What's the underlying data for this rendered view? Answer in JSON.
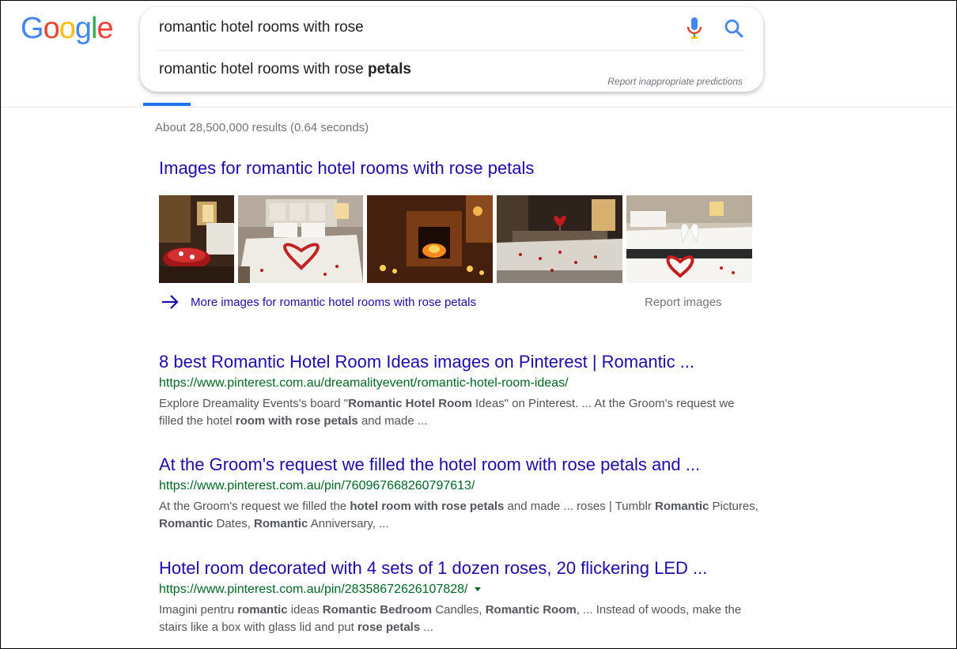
{
  "logo": {
    "letters": [
      "G",
      "o",
      "o",
      "g",
      "l",
      "e"
    ],
    "colors": [
      "#4285F4",
      "#EA4335",
      "#FBBC05",
      "#4285F4",
      "#34A853",
      "#EA4335"
    ]
  },
  "search": {
    "query": "romantic hotel rooms with rose",
    "suggestion_prefix": "romantic hotel rooms with rose ",
    "suggestion_bold": "petals",
    "report_predictions": "Report inappropriate predictions",
    "mic_icon": "microphone-icon",
    "search_icon": "magnifier-icon"
  },
  "results_stats": "About 28,500,000 results (0.64 seconds)",
  "images_block": {
    "heading": "Images for romantic hotel rooms with rose petals",
    "more_link": "More images for romantic hotel rooms with rose petals",
    "report": "Report images",
    "thumbnails": [
      "hotel room with rose petal tray",
      "bed decorated with rose petal heart",
      "candlelit fireplace room",
      "rose petals on bed with heart balloon",
      "towel swans on bed with rose petals"
    ]
  },
  "results": [
    {
      "title": "8 best Romantic Hotel Room Ideas images on Pinterest | Romantic ...",
      "url": "https://www.pinterest.com.au/dreamalityevent/romantic-hotel-room-ideas/",
      "has_caret": false,
      "snippet": [
        {
          "t": "Explore Dreamality Events's board \"",
          "b": false
        },
        {
          "t": "Romantic Hotel Room",
          "b": true
        },
        {
          "t": " Ideas\" on Pinterest. ... At the Groom's request we filled the hotel ",
          "b": false
        },
        {
          "t": "room with rose petals",
          "b": true
        },
        {
          "t": " and made ...",
          "b": false
        }
      ]
    },
    {
      "title": "At the Groom's request we filled the hotel room with rose petals and ...",
      "url": "https://www.pinterest.com.au/pin/760967668260797613/",
      "has_caret": false,
      "snippet": [
        {
          "t": "At the Groom's request we filled the ",
          "b": false
        },
        {
          "t": "hotel room with rose petals",
          "b": true
        },
        {
          "t": " and made ... roses | Tumblr ",
          "b": false
        },
        {
          "t": "Romantic",
          "b": true
        },
        {
          "t": " Pictures, ",
          "b": false
        },
        {
          "t": "Romantic",
          "b": true
        },
        {
          "t": " Dates, ",
          "b": false
        },
        {
          "t": "Romantic",
          "b": true
        },
        {
          "t": " Anniversary, ...",
          "b": false
        }
      ]
    },
    {
      "title": "Hotel room decorated with 4 sets of 1 dozen roses, 20 flickering LED ...",
      "url": "https://www.pinterest.com.au/pin/28358672626107828/",
      "has_caret": true,
      "snippet": [
        {
          "t": "Imagini pentru ",
          "b": false
        },
        {
          "t": "romantic",
          "b": true
        },
        {
          "t": " ideas ",
          "b": false
        },
        {
          "t": "Romantic Bedroom",
          "b": true
        },
        {
          "t": " Candles, ",
          "b": false
        },
        {
          "t": "Romantic Room",
          "b": true
        },
        {
          "t": ", ... Instead of woods, make the stairs like a box with glass lid and put ",
          "b": false
        },
        {
          "t": "rose petals",
          "b": true
        },
        {
          "t": " ...",
          "b": false
        }
      ]
    }
  ]
}
